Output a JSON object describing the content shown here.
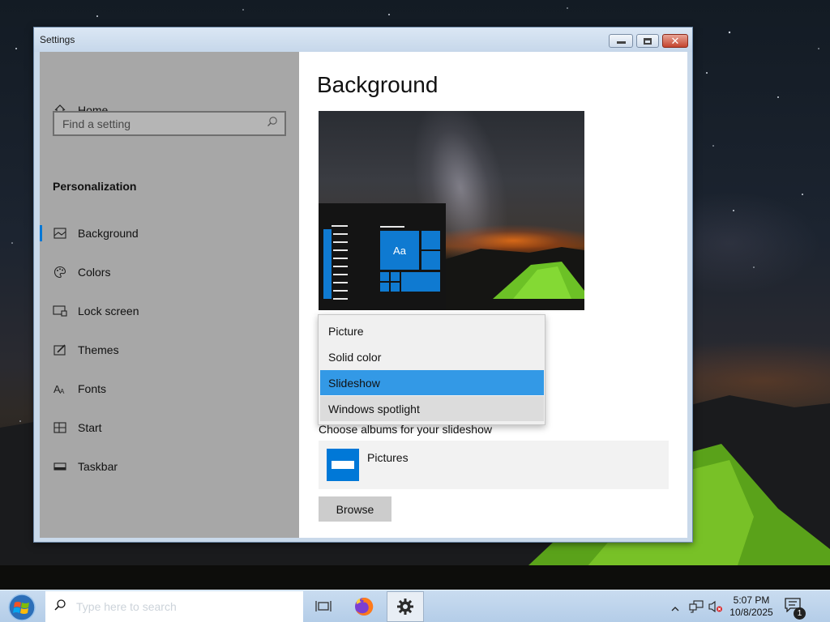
{
  "window": {
    "title": "Settings"
  },
  "sidebar": {
    "home_label": "Home",
    "search_placeholder": "Find a setting",
    "section_title": "Personalization",
    "items": [
      {
        "label": "Background",
        "icon": "picture-icon",
        "active": true
      },
      {
        "label": "Colors",
        "icon": "palette-icon",
        "active": false
      },
      {
        "label": "Lock screen",
        "icon": "lock-screen-icon",
        "active": false
      },
      {
        "label": "Themes",
        "icon": "themes-brush-icon",
        "active": false
      },
      {
        "label": "Fonts",
        "icon": "fonts-icon",
        "active": false
      },
      {
        "label": "Start",
        "icon": "start-tiles-icon",
        "active": false
      },
      {
        "label": "Taskbar",
        "icon": "taskbar-icon",
        "active": false
      }
    ]
  },
  "main": {
    "title": "Background",
    "preview_tile_text": "Aa",
    "background_dropdown": {
      "options": [
        "Picture",
        "Solid color",
        "Slideshow",
        "Windows spotlight"
      ],
      "selected": "Slideshow",
      "hovered": "Windows spotlight"
    },
    "slideshow_label": "Choose albums for your slideshow",
    "album_name": "Pictures",
    "browse_label": "Browse"
  },
  "taskbar": {
    "search_placeholder": "Type here to search",
    "apps": [
      "task-view-icon",
      "firefox-icon",
      "settings-gear-icon"
    ],
    "clock_time": "5:07 PM",
    "clock_date": "10/8/2025",
    "notification_count": "1"
  },
  "colors": {
    "accent": "#0078d7",
    "selected_option": "#3399e6",
    "sidebar_bg": "#a7a7a7"
  }
}
